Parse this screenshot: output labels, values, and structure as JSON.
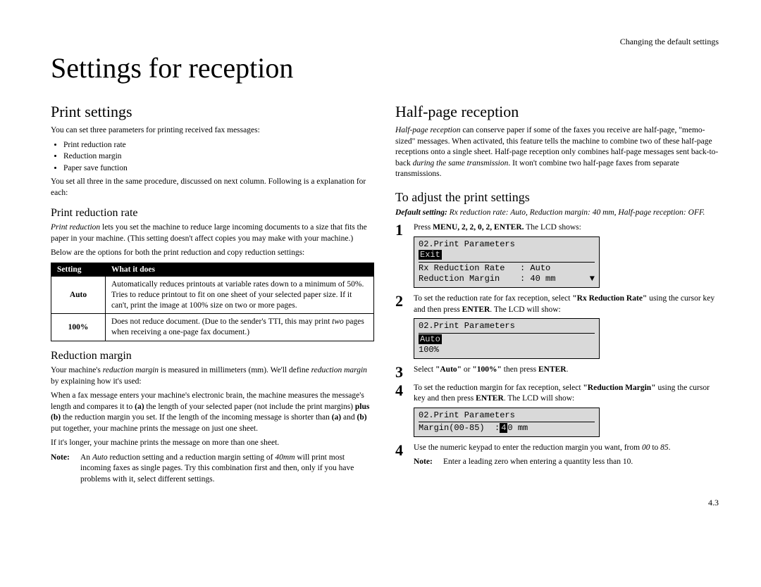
{
  "running_head": "Changing the default settings",
  "title": "Settings for reception",
  "page_number": "4.3",
  "left": {
    "h2": "Print settings",
    "intro": "You can set three parameters for printing received fax messages:",
    "bullets": [
      "Print reduction rate",
      "Reduction margin",
      "Paper save function"
    ],
    "intro_after": "You set all three in the same procedure, discussed on next column. Following is a explanation for each:",
    "sec1_h3": "Print reduction rate",
    "sec1_p1a": "Print reduction",
    "sec1_p1b": " lets you set the machine to reduce large incoming documents to a size that fits the paper in your machine. (This setting doesn't affect copies you may make with your machine.)",
    "sec1_p2": "Below are the options for both the print reduction and copy reduction settings:",
    "table": {
      "head": [
        "Setting",
        "What it does"
      ],
      "rows": [
        {
          "label": "Auto",
          "desc": "Automatically reduces printouts at variable rates down to a minimum of 50%. Tries to reduce printout to fit on one sheet of your selected paper size. If it can't, print the image at 100% size on two or more pages."
        },
        {
          "label": "100%",
          "desc_a": "Does not reduce document. (Due to the sender's ",
          "desc_tti": "TTI",
          "desc_b": ", this may print ",
          "desc_i": "two",
          "desc_c": " pages when receiving a one-page fax document.)"
        }
      ]
    },
    "sec2_h3": "Reduction margin",
    "sec2_p1a": "Your machine's ",
    "sec2_p1i": "reduction margin",
    "sec2_p1b": " is measured in millimeters (mm). We'll define ",
    "sec2_p1i2": "reduction margin",
    "sec2_p1c": " by explaining how it's used:",
    "sec2_p2": "When a fax message enters your machine's electronic brain, the machine measures the message's length and compares it to (a) the length of your selected paper (not include the print margins) plus (b) the reduction margin you set. If the length of the incoming message is shorter than (a) and (b) put together, your machine prints the message on just one sheet.",
    "sec2_p3": "If it's longer, your machine prints the message on more than one sheet.",
    "sec2_note_label": "Note:",
    "sec2_note_a": "An ",
    "sec2_note_i1": "Auto",
    "sec2_note_b": " reduction setting and a reduction margin setting of ",
    "sec2_note_i2": "40mm",
    "sec2_note_c": " will print most incoming faxes as single pages. Try this combination first and then, only if you have problems with it, select different settings."
  },
  "right": {
    "h2a": "Half-page reception",
    "hp_p1a": "Half-page reception",
    "hp_p1b": " can conserve paper if some of the faxes you receive are half-page, \"memo-sized\" messages. When activated, this feature tells the machine to combine two of these half-page receptions onto a single sheet. Half-page reception only combines half-page messages sent back-to-back ",
    "hp_p1i": "during the same transmission",
    "hp_p1c": ". It won't combine two half-page faxes from separate transmissions.",
    "h2b": "To adjust the print settings",
    "default_label": "Default setting:",
    "default_val": "Rx reduction rate: Auto, Reduction margin: 40 mm, Half-page reception: OFF.",
    "steps": {
      "s1_a": "Press ",
      "s1_k": "MENU, 2, 2, 0, 2, ENTER.",
      "s1_b": " The ",
      "s1_lcd": "LCD",
      "s1_c": " shows:",
      "lcd1_l1": "02.Print Parameters",
      "lcd1_l2": "Exit",
      "lcd1_l3": "Rx Reduction Rate   : Auto",
      "lcd1_l4": "Reduction Margin    : 40 mm",
      "s2_a": "To set the reduction rate for fax reception, select ",
      "s2_b": "\"Rx Reduction Rate\"",
      "s2_c": " using the cursor key and then press ",
      "s2_enter": "ENTER",
      "s2_d": ". The ",
      "s2_lcd": "LCD",
      "s2_e": " will show:",
      "lcd2_l1": "02.Print Parameters",
      "lcd2_l2": "Auto",
      "lcd2_l3": "100%",
      "s3_a": "Select ",
      "s3_b": "\"Auto\"",
      "s3_c": " or ",
      "s3_d": "\"100%\"",
      "s3_e": " then press ",
      "s3_enter": "ENTER",
      "s3_f": ".",
      "s4_a": "To set the reduction margin for fax reception, select ",
      "s4_b": "\"Reduction Margin\"",
      "s4_c": " using the cursor key and then press ",
      "s4_enter": "ENTER",
      "s4_d": ". The ",
      "s4_lcd": "LCD",
      "s4_e": " will show:",
      "lcd3_l1": "02.Print Parameters",
      "lcd3_l2a": "Margin(00-85)  :",
      "lcd3_l2b": "4",
      "lcd3_l2c": "0 mm",
      "s5_a": "Use the numeric keypad to enter the reduction margin you want, from ",
      "s5_i1": "00",
      "s5_b": " to ",
      "s5_i2": "85",
      "s5_c": ".",
      "s5_note_label": "Note:",
      "s5_note": "Enter a leading zero when entering a quantity less than 10."
    }
  }
}
